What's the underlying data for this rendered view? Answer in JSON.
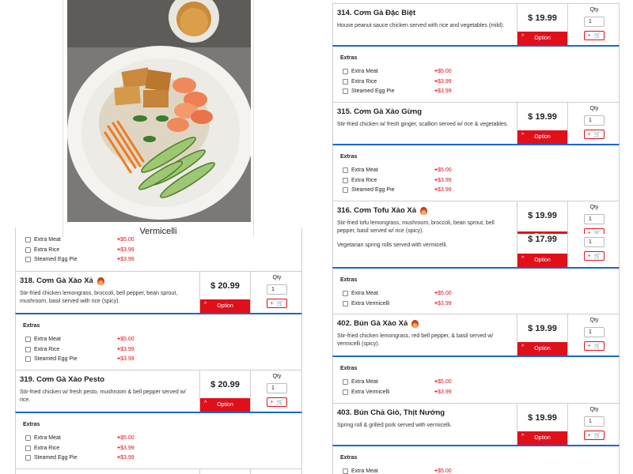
{
  "currency": "$",
  "qty_label": "Qty",
  "option_label": "Option",
  "extras_label": "Extras",
  "photo": {
    "caption": "Vermicelli"
  },
  "left": {
    "top_extras": [
      {
        "name": "Extra Meat",
        "price": "$5.00"
      },
      {
        "name": "Extra Rice",
        "price": "$3.99"
      },
      {
        "name": "Steamed Egg Pie",
        "price": "$3.99"
      }
    ],
    "items": [
      {
        "title": "318. Cơm Gà Xào Xả",
        "spicy": true,
        "desc": "Stir-fried chicken lemongrass, broccoli, bell pepper, bean sprout, mushroom, basil served with rice (spicy).",
        "price": "$ 20.99",
        "qty": "1",
        "extras": [
          {
            "name": "Extra Meat",
            "price": "$5.00"
          },
          {
            "name": "Extra Rice",
            "price": "$3.99"
          },
          {
            "name": "Steamed Egg Pie",
            "price": "$3.99"
          }
        ]
      },
      {
        "title": "319. Cơm Gà Xào Pesto",
        "spicy": false,
        "desc": "Stir-fried chicken w/ fresh pesto, mushroom & bell pepper served w/ rice.",
        "price": "$ 20.99",
        "qty": "1",
        "extras": [
          {
            "name": "Extra Meat",
            "price": "$5.00"
          },
          {
            "name": "Extra Rice",
            "price": "$3.99"
          },
          {
            "name": "Steamed Egg Pie",
            "price": "$3.99"
          }
        ]
      }
    ]
  },
  "right": {
    "items": [
      {
        "title": "314. Cơm Gà Đặc Biệt",
        "spicy": false,
        "desc": "House peanut sauce chicken served with rice and vegetables (mild).",
        "price": "$ 19.99",
        "qty": "1",
        "extras": [
          {
            "name": "Extra Meat",
            "price": "$5.00"
          },
          {
            "name": "Extra Rice",
            "price": "$3.99"
          },
          {
            "name": "Steamed Egg Pie",
            "price": "$3.99"
          }
        ]
      },
      {
        "title": "315. Cơm Gà Xào Gừng",
        "spicy": false,
        "desc": "Stir-fried chicken w/ fresh ginger, scallion served w/ rice & vegetables.",
        "price": "$ 19.99",
        "qty": "1",
        "extras": [
          {
            "name": "Extra Meat",
            "price": "$5.00"
          },
          {
            "name": "Extra Rice",
            "price": "$3.99"
          },
          {
            "name": "Steamed Egg Pie",
            "price": "$3.99"
          }
        ]
      },
      {
        "title": "316. Cơm Tofu Xào Xả",
        "spicy": true,
        "desc": "Stir-fried tofu lemongrass, mushroom, broccoli, bean sprout, bell pepper, basil served w/ rice (spicy).",
        "price": "$ 19.99",
        "qty": "1"
      },
      {
        "title": "",
        "spicy": false,
        "desc": "Vegetarian spring rolls served with vermicelli.",
        "price": "$ 17.99",
        "qty": "1",
        "extras": [
          {
            "name": "Extra Meat",
            "price": "$5.00"
          },
          {
            "name": "Extra Vermicelli",
            "price": "$3.99"
          }
        ]
      },
      {
        "title": "402. Bún Gà Xào Xả",
        "spicy": true,
        "desc": "Stir-fried chicken lemongrass, red bell pepper, & basil served w/ vermicelli (spicy).",
        "price": "$ 19.99",
        "qty": "1",
        "extras": [
          {
            "name": "Extra Meat",
            "price": "$5.00"
          },
          {
            "name": "Extra Vermicelli",
            "price": "$3.99"
          }
        ]
      },
      {
        "title": "403. Bún Chả Giò, Thịt Nướng",
        "spicy": false,
        "desc": "Spring roll & grilled pork served with vermicelli.",
        "price": "$ 19.99",
        "qty": "1",
        "extras": [
          {
            "name": "Extra Meat",
            "price": "$5.00"
          }
        ]
      }
    ]
  }
}
